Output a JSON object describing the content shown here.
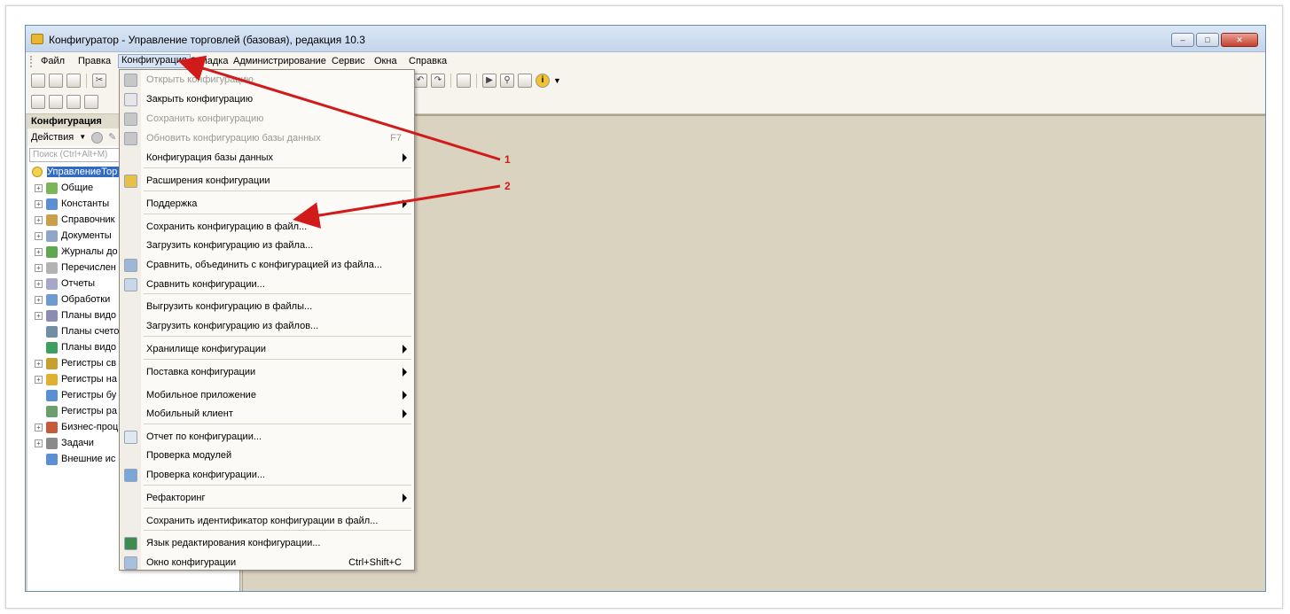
{
  "window": {
    "title": "Конфигуратор - Управление торговлей (базовая), редакция 10.3"
  },
  "menubar": {
    "items": [
      "Файл",
      "Правка",
      "Конфигурация",
      "Отладка",
      "Администрирование",
      "Сервис",
      "Окна",
      "Справка"
    ],
    "active": "Конфигурация"
  },
  "panel": {
    "title": "Конфигурация",
    "actions_label": "Действия",
    "search_placeholder": "Поиск (Ctrl+Alt+M)",
    "root_label": "УправлениеТор",
    "items": [
      {
        "label": "Общие",
        "icon": "common-icon",
        "expandable": true
      },
      {
        "label": "Константы",
        "icon": "constants-icon",
        "expandable": true
      },
      {
        "label": "Справочник",
        "icon": "catalogs-icon",
        "expandable": true
      },
      {
        "label": "Документы",
        "icon": "documents-icon",
        "expandable": true
      },
      {
        "label": "Журналы до",
        "icon": "journals-icon",
        "expandable": true
      },
      {
        "label": "Перечислен",
        "icon": "enums-icon",
        "expandable": true
      },
      {
        "label": "Отчеты",
        "icon": "reports-icon",
        "expandable": true
      },
      {
        "label": "Обработки",
        "icon": "processing-icon",
        "expandable": true
      },
      {
        "label": "Планы видо",
        "icon": "charts-of-characteristics-icon",
        "expandable": true
      },
      {
        "label": "Планы счето",
        "icon": "charts-of-accounts-icon",
        "expandable": false
      },
      {
        "label": "Планы видо",
        "icon": "charts-of-calc-icon",
        "expandable": false
      },
      {
        "label": "Регистры св",
        "icon": "info-registers-icon",
        "expandable": true
      },
      {
        "label": "Регистры на",
        "icon": "accum-registers-icon",
        "expandable": true
      },
      {
        "label": "Регистры бу",
        "icon": "accounting-registers-icon",
        "expandable": false
      },
      {
        "label": "Регистры ра",
        "icon": "calc-registers-icon",
        "expandable": false
      },
      {
        "label": "Бизнес-проц",
        "icon": "business-process-icon",
        "expandable": true
      },
      {
        "label": "Задачи",
        "icon": "tasks-icon",
        "expandable": true
      },
      {
        "label": "Внешние ис",
        "icon": "external-sources-icon",
        "expandable": false
      }
    ]
  },
  "dropdown": {
    "items": [
      {
        "label": "Открыть конфигурацию",
        "disabled": true,
        "key": "",
        "submenu": false,
        "icon": "open-config-icon"
      },
      {
        "label": "Закрыть конфигурацию",
        "disabled": false,
        "key": "",
        "submenu": false,
        "icon": "close-config-icon"
      },
      {
        "label": "Сохранить конфигурацию",
        "disabled": true,
        "key": "",
        "submenu": false,
        "icon": "save-config-icon"
      },
      {
        "label": "Обновить конфигурацию базы данных",
        "disabled": true,
        "key": "F7",
        "submenu": false,
        "icon": "update-db-config-icon"
      },
      {
        "label": "Конфигурация базы данных",
        "disabled": false,
        "key": "",
        "submenu": true,
        "icon": ""
      },
      {
        "label": "Расширения конфигурации",
        "disabled": false,
        "key": "",
        "submenu": false,
        "icon": "extensions-icon"
      },
      {
        "label": "Поддержка",
        "disabled": false,
        "key": "",
        "submenu": true,
        "icon": ""
      },
      {
        "label": "Сохранить конфигурацию в файл...",
        "disabled": false,
        "key": "",
        "submenu": false,
        "icon": ""
      },
      {
        "label": "Загрузить конфигурацию из файла...",
        "disabled": false,
        "key": "",
        "submenu": false,
        "icon": ""
      },
      {
        "label": "Сравнить, объединить с конфигурацией из файла...",
        "disabled": false,
        "key": "",
        "submenu": false,
        "icon": "compare-merge-icon"
      },
      {
        "label": "Сравнить конфигурации...",
        "disabled": false,
        "key": "",
        "submenu": false,
        "icon": "compare-icon"
      },
      {
        "label": "Выгрузить конфигурацию в файлы...",
        "disabled": false,
        "key": "",
        "submenu": false,
        "icon": ""
      },
      {
        "label": "Загрузить конфигурацию из файлов...",
        "disabled": false,
        "key": "",
        "submenu": false,
        "icon": ""
      },
      {
        "label": "Хранилище конфигурации",
        "disabled": false,
        "key": "",
        "submenu": true,
        "icon": ""
      },
      {
        "label": "Поставка конфигурации",
        "disabled": false,
        "key": "",
        "submenu": true,
        "icon": ""
      },
      {
        "label": "Мобильное приложение",
        "disabled": false,
        "key": "",
        "submenu": true,
        "icon": ""
      },
      {
        "label": "Мобильный клиент",
        "disabled": false,
        "key": "",
        "submenu": true,
        "icon": ""
      },
      {
        "label": "Отчет по конфигурации...",
        "disabled": false,
        "key": "",
        "submenu": false,
        "icon": "config-report-icon"
      },
      {
        "label": "Проверка модулей",
        "disabled": false,
        "key": "",
        "submenu": false,
        "icon": ""
      },
      {
        "label": "Проверка конфигурации...",
        "disabled": false,
        "key": "",
        "submenu": false,
        "icon": "check-config-icon"
      },
      {
        "label": "Рефакторинг",
        "disabled": false,
        "key": "",
        "submenu": true,
        "icon": ""
      },
      {
        "label": "Сохранить идентификатор конфигурации в файл...",
        "disabled": false,
        "key": "",
        "submenu": false,
        "icon": ""
      },
      {
        "label": "Язык редактирования конфигурации...",
        "disabled": false,
        "key": "",
        "submenu": false,
        "icon": "language-icon"
      },
      {
        "label": "Окно конфигурации",
        "disabled": false,
        "key": "Ctrl+Shift+C",
        "submenu": false,
        "icon": "config-window-icon"
      }
    ]
  },
  "annotations": [
    "1",
    "2"
  ],
  "colors": {
    "arrow": "#d11a1a",
    "selection": "#316ac5"
  }
}
